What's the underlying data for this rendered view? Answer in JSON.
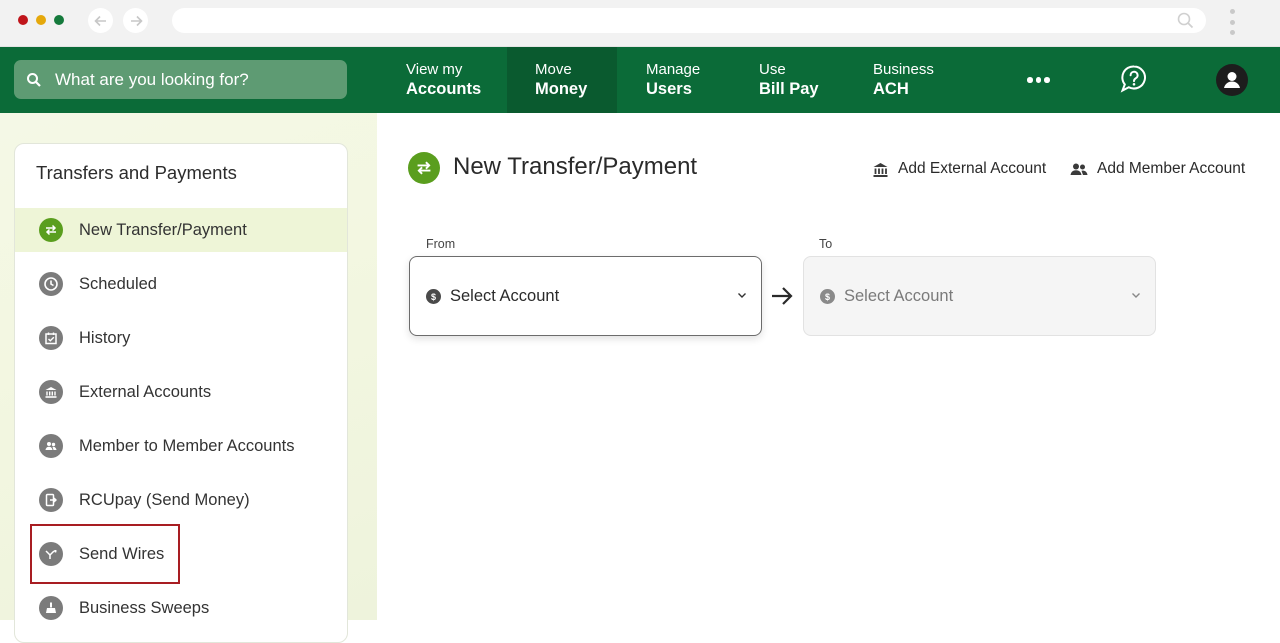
{
  "search": {
    "placeholder": "What are you looking for?"
  },
  "nav": [
    {
      "line1": "View my",
      "line2": "Accounts"
    },
    {
      "line1": "Move",
      "line2": "Money"
    },
    {
      "line1": "Manage",
      "line2": "Users"
    },
    {
      "line1": "Use",
      "line2": "Bill Pay"
    },
    {
      "line1": "Business",
      "line2": "ACH"
    }
  ],
  "sidebar": {
    "title": "Transfers and Payments",
    "items": [
      {
        "label": "New Transfer/Payment",
        "icon": "transfer-icon"
      },
      {
        "label": "Scheduled",
        "icon": "clock-icon"
      },
      {
        "label": "History",
        "icon": "calendar-icon"
      },
      {
        "label": "External Accounts",
        "icon": "bank-icon"
      },
      {
        "label": "Member to Member Accounts",
        "icon": "people-icon"
      },
      {
        "label": "RCUpay (Send Money)",
        "icon": "send-money-icon"
      },
      {
        "label": "Send Wires",
        "icon": "wire-icon"
      },
      {
        "label": "Business Sweeps",
        "icon": "sweep-icon"
      }
    ]
  },
  "main": {
    "title": "New Transfer/Payment",
    "add_external": "Add External Account",
    "add_member": "Add Member Account",
    "from_label": "From",
    "to_label": "To",
    "from_select": "Select Account",
    "to_select": "Select Account"
  },
  "colors": {
    "brand_green": "#0b6b38",
    "active_nav": "#0a5a2f",
    "accent_lime": "#5a9e1e",
    "highlight_red": "#a81d22"
  }
}
